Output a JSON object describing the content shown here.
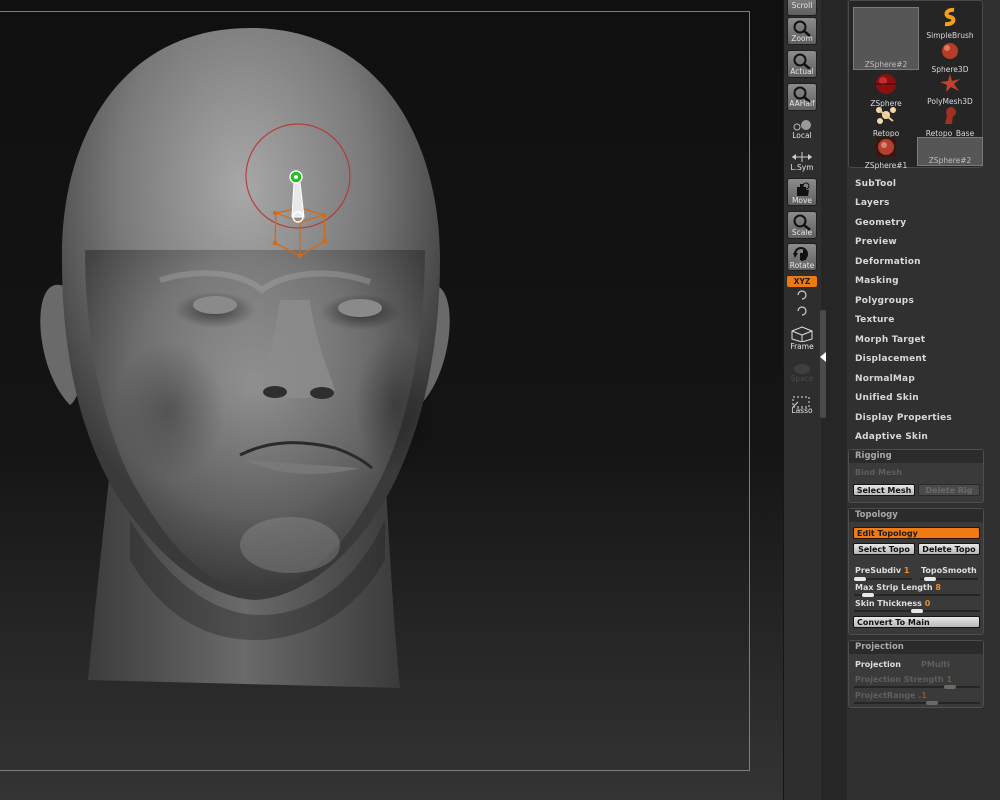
{
  "shelf": {
    "scroll_label": "Scroll",
    "zoom_label": "Zoom",
    "actual_label": "Actual",
    "aahalf_label": "AAHalf",
    "local_label": "Local",
    "lsym_label": "L.Sym",
    "move_label": "Move",
    "scale_label": "Scale",
    "rotate_label": "Rotate",
    "xyz_label": "XYZ",
    "frame_label": "Frame",
    "space_label": "Space",
    "lasso_label": "Lasso"
  },
  "tool_palette": {
    "items": [
      {
        "label": "ZSphere#2",
        "icon": "zsphere-large-icon"
      },
      {
        "label": "SimpleBrush",
        "icon": "simplebrush-icon"
      },
      {
        "label": "Sphere3D",
        "icon": "sphere3d-icon"
      },
      {
        "label": "ZSphere",
        "icon": "zsphere-icon"
      },
      {
        "label": "PolyMesh3D",
        "icon": "polymesh3d-icon"
      },
      {
        "label": "Retopo",
        "icon": "retopo-icon"
      },
      {
        "label": "Retopo_Base",
        "icon": "retopo-base-icon"
      },
      {
        "label": "ZSphere#1",
        "icon": "zsphere1-icon"
      },
      {
        "label": "ZSphere#2",
        "icon": "zsphere2-icon"
      }
    ]
  },
  "menu": {
    "subtool": "SubTool",
    "layers": "Layers",
    "geometry": "Geometry",
    "preview": "Preview",
    "deformation": "Deformation",
    "masking": "Masking",
    "polygroups": "Polygroups",
    "texture": "Texture",
    "morph_target": "Morph Target",
    "displacement": "Displacement",
    "normalmap": "NormalMap",
    "unified_skin": "Unified Skin",
    "display_properties": "Display Properties",
    "adaptive_skin": "Adaptive Skin"
  },
  "rigging": {
    "title": "Rigging",
    "bind_mesh": "Bind Mesh",
    "select_mesh": "Select Mesh",
    "delete_rig": "Delete Rig"
  },
  "topology": {
    "title": "Topology",
    "edit_topology": "Edit Topology",
    "select_topo": "Select Topo",
    "delete_topo": "Delete Topo",
    "presubdiv_label": "PreSubdiv",
    "presubdiv_value": "1",
    "toposmooth_label": "TopoSmooth",
    "max_strip_label": "Max Strip Length",
    "max_strip_value": "8",
    "skin_thickness_label": "Skin Thickness",
    "skin_thickness_value": "0",
    "convert_to_main": "Convert To Main"
  },
  "projection": {
    "title": "Projection",
    "projection_label": "Projection",
    "pmulti_label": "PMulti",
    "strength_label": "Projection Strength",
    "strength_value": "1",
    "range_label": "ProjectRange",
    "range_value": ".1"
  },
  "colors": {
    "accent_orange": "#f07a14",
    "zsphere_link_green": "#22c020",
    "brush_circle_red": "#b8302a"
  }
}
